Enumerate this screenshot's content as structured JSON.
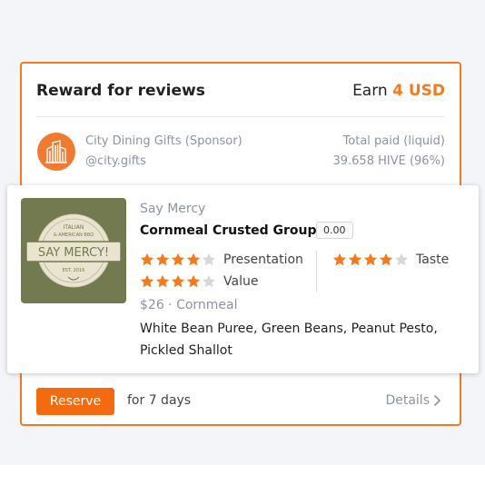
{
  "reward": {
    "title": "Reward for reviews",
    "earn_label": "Earn",
    "earn_amount": "4 USD",
    "sponsor_name": "City Dining Gifts (Sponsor)",
    "sponsor_handle": "@city.gifts",
    "total_paid_label": "Total paid (liquid)",
    "total_paid_value": "39.658 HIVE (96%)",
    "reserve_label": "Reserve",
    "duration_text": "for 7 days",
    "details_label": "Details"
  },
  "dish": {
    "restaurant": "Say Mercy",
    "name": "Cornmeal Crusted Grouper",
    "score": "0.00",
    "ratings": [
      {
        "label": "Presentation",
        "stars": 4,
        "max": 5
      },
      {
        "label": "Value",
        "stars": 4,
        "max": 5
      },
      {
        "label": "Taste",
        "stars": 4,
        "max": 5
      }
    ],
    "price_line": "$26 · Cornmeal",
    "description": "White Bean Puree, Green Beans, Peanut Pesto, Pickled Shallot",
    "logo": {
      "main": "SAY MERCY!",
      "top_line": "ITALIAN",
      "sub_line": "& AMERICAN BBQ",
      "est_line": "EST. 2016"
    }
  },
  "colors": {
    "accent": "#f47a20",
    "button": "#f46a0f",
    "star_filled": "#f47a20",
    "star_empty": "#d8d8d8",
    "muted_text": "#8d93a1",
    "logo_bg": "#737a4f"
  },
  "icons": {
    "sponsor_logo": "city-buildings-icon",
    "details_arrow": "chevron-right-icon",
    "star": "star-icon"
  }
}
